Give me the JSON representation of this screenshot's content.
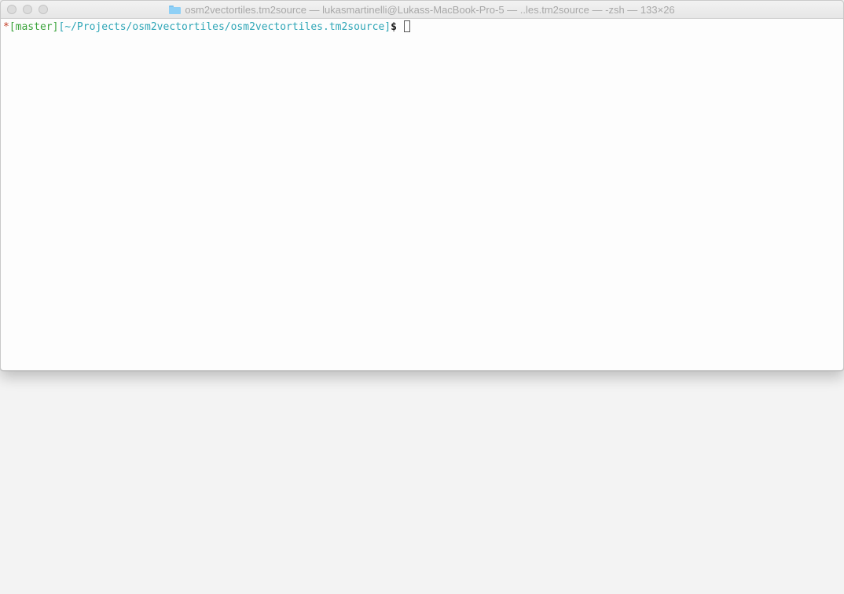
{
  "window": {
    "title": "osm2vectortiles.tm2source — lukasmartinelli@Lukass-MacBook-Pro-5 — ..les.tm2source — -zsh — 133×26",
    "folder_icon": "folder-icon",
    "traffic_lights": [
      "close-button",
      "minimize-button",
      "zoom-button"
    ]
  },
  "prompt": {
    "dirty_marker": "*",
    "branch_open": "[",
    "branch": "master",
    "branch_close": "]",
    "path": "[~/Projects/osm2vectortiles/osm2vectortiles.tm2source]",
    "symbol": "$",
    "command": ""
  },
  "colors": {
    "dirty_marker": "#c23b22",
    "branch": "#3aa33a",
    "path": "#2fa6b7",
    "window_bg": "#fdfdfd",
    "desktop_bg": "#f3f3f3"
  }
}
